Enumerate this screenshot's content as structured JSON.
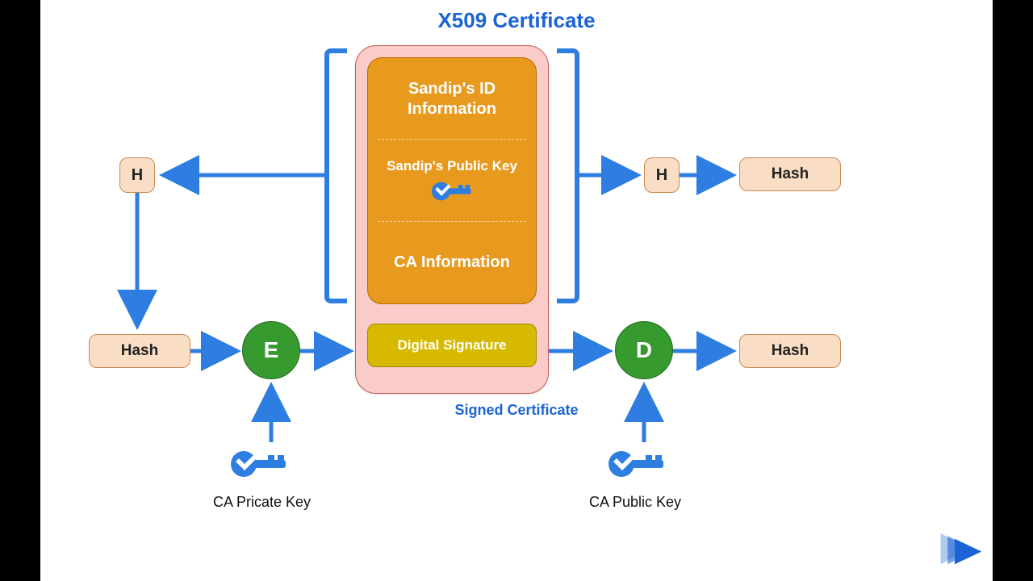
{
  "title": "X509 Certificate",
  "subtitle": "Signed Certificate",
  "certificate": {
    "row1": "Sandip's ID Information",
    "row2": "Sandip's Public Key",
    "row3": "CA Information",
    "signature": "Digital Signature"
  },
  "nodes": {
    "h_left": "H",
    "h_right": "H",
    "hash_left": "Hash",
    "hash_right_top": "Hash",
    "hash_right_bottom": "Hash",
    "encrypt": "E",
    "decrypt": "D"
  },
  "keys": {
    "ca_private": "CA Pricate Key",
    "ca_public": "CA Public Key"
  },
  "colors": {
    "blue": "#2e7de0",
    "orange": "#e89a1f",
    "green": "#369a2f",
    "yellow": "#d6b900"
  }
}
